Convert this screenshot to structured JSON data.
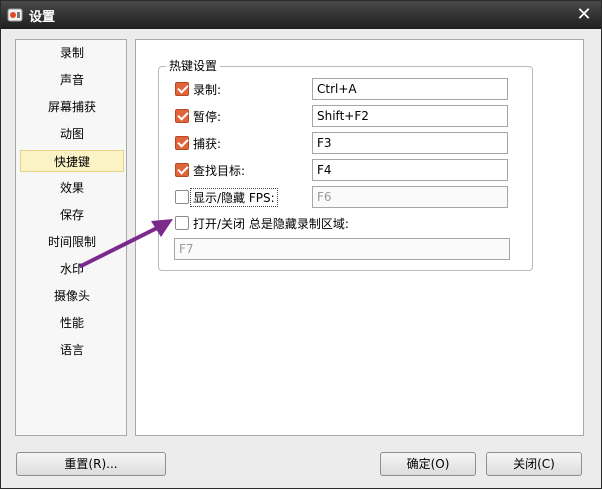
{
  "window": {
    "title": "设置",
    "close_symbol": "✕"
  },
  "sidebar": {
    "items": [
      {
        "label": "录制"
      },
      {
        "label": "声音"
      },
      {
        "label": "屏幕捕获"
      },
      {
        "label": "动图"
      },
      {
        "label": "快捷键"
      },
      {
        "label": "效果"
      },
      {
        "label": "保存"
      },
      {
        "label": "时间限制"
      },
      {
        "label": "水印"
      },
      {
        "label": "摄像头"
      },
      {
        "label": "性能"
      },
      {
        "label": "语言"
      }
    ],
    "active_index": 4
  },
  "hotkeys": {
    "group_title": "热键设置",
    "rows": [
      {
        "label": "录制:",
        "checked": true,
        "value": "Ctrl+A"
      },
      {
        "label": "暂停:",
        "checked": true,
        "value": "Shift+F2"
      },
      {
        "label": "捕获:",
        "checked": true,
        "value": "F3"
      },
      {
        "label": "查找目标:",
        "checked": true,
        "value": "F4"
      },
      {
        "label": "显示/隐藏 FPS:",
        "checked": false,
        "value": "F6"
      }
    ],
    "extra": {
      "label": "打开/关闭 总是隐藏录制区域:",
      "checked": false,
      "value": "F7"
    }
  },
  "buttons": {
    "reset": "重置(R)...",
    "ok": "确定(O)",
    "close": "关闭(C)"
  },
  "colors": {
    "checkbox_checked": "#e0653a",
    "active_item_bg": "#fbf3c5",
    "annotation_arrow": "#7b2a8c"
  }
}
